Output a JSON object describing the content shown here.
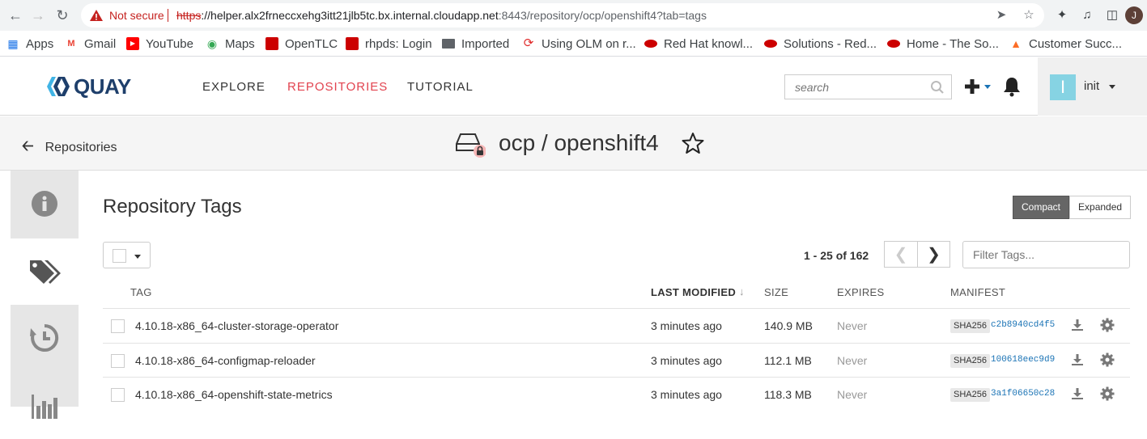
{
  "browser": {
    "not_secure": "Not secure",
    "url_scheme": "https",
    "url_host": "://helper.alx2frneccxehg3itt21jlb5tc.bx.internal.cloudapp.net",
    "url_rest": ":8443/repository/ocp/openshift4?tab=tags",
    "profile_initial": "J",
    "bookmarks": [
      {
        "label": "Apps",
        "icon": "apps-grid-icon",
        "color": "#1a73e8"
      },
      {
        "label": "Gmail",
        "icon": "gmail-icon",
        "color": "#ea4335"
      },
      {
        "label": "YouTube",
        "icon": "youtube-icon",
        "color": "#ff0000"
      },
      {
        "label": "Maps",
        "icon": "maps-pin-icon",
        "color": "#34a853"
      },
      {
        "label": "OpenTLC",
        "icon": "redhat-favicon",
        "color": "#cc0000"
      },
      {
        "label": "rhpds: Login",
        "icon": "redhat-favicon",
        "color": "#cc0000"
      },
      {
        "label": "Imported",
        "icon": "folder-icon",
        "color": "#5f6368"
      },
      {
        "label": "Using OLM on r...",
        "icon": "openshift-favicon",
        "color": "#e02b2b"
      },
      {
        "label": "Red Hat knowl...",
        "icon": "redhat-hat-icon",
        "color": "#cc0000"
      },
      {
        "label": "Solutions - Red...",
        "icon": "redhat-hat-icon",
        "color": "#cc0000"
      },
      {
        "label": "Home - The So...",
        "icon": "redhat-hat-icon",
        "color": "#cc0000"
      },
      {
        "label": "Customer Succ...",
        "icon": "gitlab-icon",
        "color": "#fc6d26"
      }
    ]
  },
  "header": {
    "logo_text": "QUAY",
    "nav": [
      {
        "label": "EXPLORE",
        "active": false
      },
      {
        "label": "REPOSITORIES",
        "active": true
      },
      {
        "label": "TUTORIAL",
        "active": false
      }
    ],
    "search_placeholder": "search",
    "user_initial": "I",
    "user_name": "init"
  },
  "repo": {
    "back_label": "Repositories",
    "title": "ocp / openshift4"
  },
  "tags_panel": {
    "title": "Repository Tags",
    "view_options": [
      {
        "label": "Compact",
        "active": true
      },
      {
        "label": "Expanded",
        "active": false
      }
    ],
    "paging": "1 - 25 of 162",
    "filter_placeholder": "Filter Tags...",
    "columns": {
      "tag": "TAG",
      "last_modified": "LAST MODIFIED",
      "size": "SIZE",
      "expires": "EXPIRES",
      "manifest": "MANIFEST"
    },
    "rows": [
      {
        "tag": "4.10.18-x86_64-cluster-storage-operator",
        "modified": "3 minutes ago",
        "size": "140.9 MB",
        "expires": "Never",
        "sha_label": "SHA256",
        "sha": "c2b8940cd4f5"
      },
      {
        "tag": "4.10.18-x86_64-configmap-reloader",
        "modified": "3 minutes ago",
        "size": "112.1 MB",
        "expires": "Never",
        "sha_label": "SHA256",
        "sha": "100618eec9d9"
      },
      {
        "tag": "4.10.18-x86_64-openshift-state-metrics",
        "modified": "3 minutes ago",
        "size": "118.3 MB",
        "expires": "Never",
        "sha_label": "SHA256",
        "sha": "3a1f06650c28"
      }
    ]
  },
  "colors": {
    "accent_red": "#e2434f",
    "quay_blue": "#1e3f6b",
    "avatar_teal": "#86d3e3"
  }
}
